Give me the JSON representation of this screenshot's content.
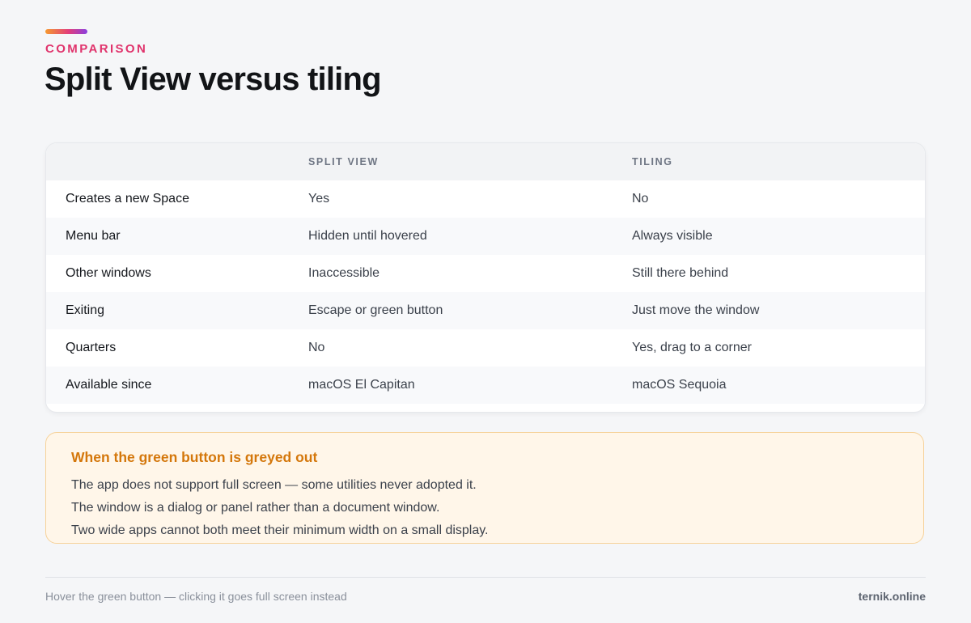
{
  "header": {
    "eyebrow": "COMPARISON",
    "title": "Split View versus tiling",
    "accent_gradient": [
      "#f59a2f",
      "#e23d7a",
      "#8a3fe0"
    ]
  },
  "table": {
    "columns": [
      "",
      "SPLIT VIEW",
      "TILING"
    ],
    "rows": [
      {
        "feature": "Creates a new Space",
        "split_view": "Yes",
        "tiling": "No"
      },
      {
        "feature": "Menu bar",
        "split_view": "Hidden until hovered",
        "tiling": "Always visible"
      },
      {
        "feature": "Other windows",
        "split_view": "Inaccessible",
        "tiling": "Still there behind"
      },
      {
        "feature": "Exiting",
        "split_view": "Escape or green button",
        "tiling": "Just move the window"
      },
      {
        "feature": "Quarters",
        "split_view": "No",
        "tiling": "Yes, drag to a corner"
      },
      {
        "feature": "Available since",
        "split_view": "macOS El Capitan",
        "tiling": "macOS Sequoia"
      }
    ]
  },
  "callout": {
    "title": "When the green button is greyed out",
    "lines": [
      "The app does not support full screen — some utilities never adopted it.",
      "The window is a dialog or panel rather than a document window.",
      "Two wide apps cannot both meet their minimum width on a small display."
    ],
    "accent_color": "#d4770b"
  },
  "footer": {
    "note": "Hover the green button — clicking it goes full screen instead",
    "brand": "ternik.online"
  }
}
